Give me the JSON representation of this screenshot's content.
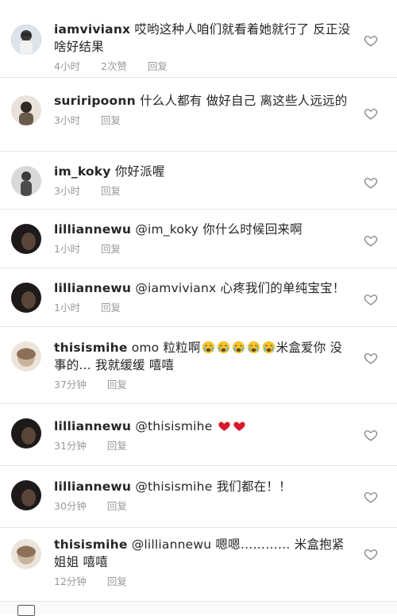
{
  "comments": [
    {
      "username": "iamvivianx",
      "text": "哎哟这种人咱们就看着她就行了 反正没啥好结果",
      "time": "4小时",
      "likes": "2次赞",
      "reply": "回复",
      "avatar_color": "#4a5a6a"
    },
    {
      "username": "suriripoonn",
      "text": "什么人都有 做好自己 离这些人远远的",
      "time": "3小时",
      "reply": "回复",
      "avatar_color": "#8a7a6a"
    },
    {
      "username": "im_koky",
      "text": "你好派喔",
      "time": "3小时",
      "reply": "回复",
      "avatar_color": "#5a5a5a"
    },
    {
      "username": "lilliannewu",
      "text": "@im_koky 你什么时候回来啊",
      "time": "1小时",
      "reply": "回复",
      "avatar_color": "#2a2020"
    },
    {
      "username": "lilliannewu",
      "text": "@iamvivianx 心疼我们的单纯宝宝！",
      "time": "1小时",
      "reply": "回复",
      "avatar_color": "#2a2020"
    },
    {
      "username": "thisismihe",
      "text_before": "omo 粒粒啊",
      "text_after": "米盒爱你 没事的... 我就缓缓 嘻嘻",
      "emoji_count": 5,
      "time": "37分钟",
      "reply": "回复",
      "avatar_color": "#c9b8a2"
    },
    {
      "username": "lilliannewu",
      "text": "@thisismihe",
      "hearts": 2,
      "time": "31分钟",
      "reply": "回复",
      "avatar_color": "#2a2020"
    },
    {
      "username": "lilliannewu",
      "text": "@thisismihe 我们都在！！",
      "time": "30分钟",
      "reply": "回复",
      "avatar_color": "#2a2020"
    },
    {
      "username": "thisismihe",
      "text": "@lilliannewu 嗯嗯………… 米盒抱紧姐姐 嘻嘻",
      "time": "12分钟",
      "reply": "回复",
      "avatar_color": "#c9b8a2"
    }
  ],
  "icons": {
    "like": "heart-outline-icon",
    "emoji": "crying-face-icon",
    "red_heart": "red-heart-icon"
  }
}
